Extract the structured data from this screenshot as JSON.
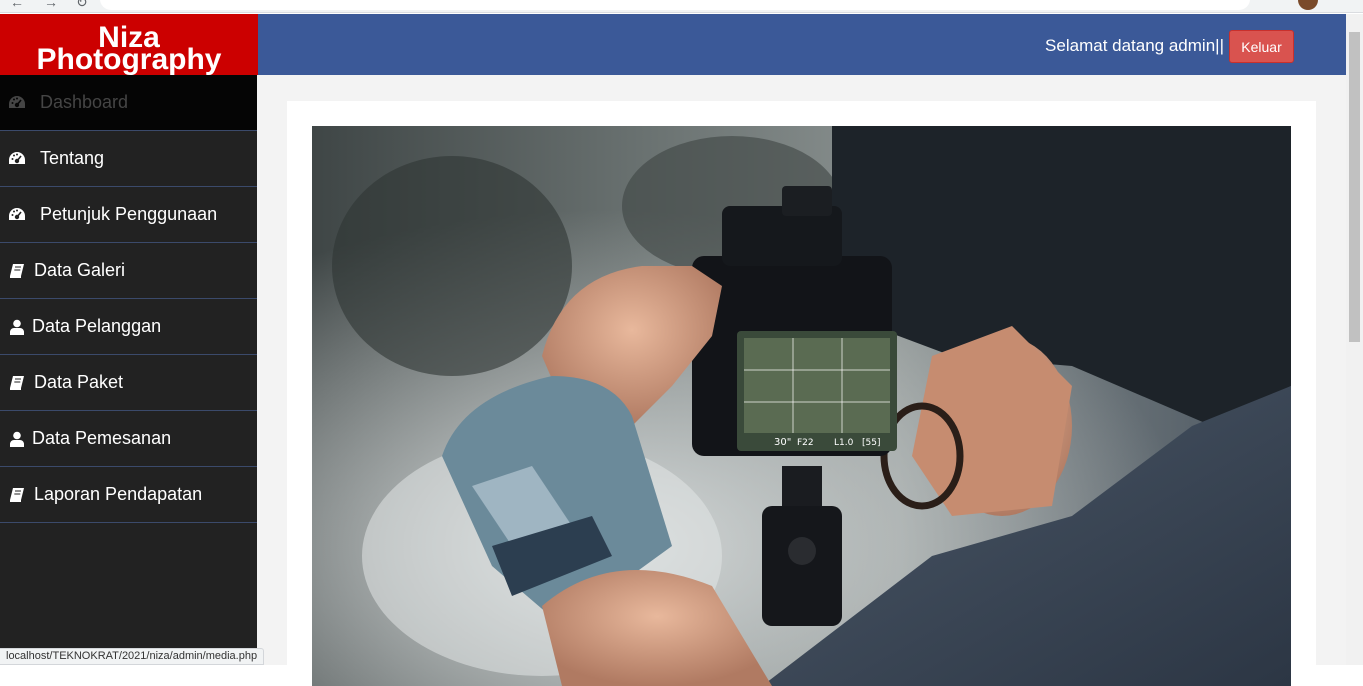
{
  "brand": {
    "line1": "Niza",
    "line2": "Photography",
    "color": "#cc0000"
  },
  "header": {
    "welcome": "Selamat datang admin||",
    "logout_label": "Keluar",
    "color": "#3b5998",
    "logout_color": "#d9534f"
  },
  "sidebar": {
    "items": [
      {
        "label": "Dashboard",
        "icon": "dashboard-icon",
        "active": true
      },
      {
        "label": "Tentang",
        "icon": "dashboard-icon",
        "active": false
      },
      {
        "label": "Petunjuk Penggunaan",
        "icon": "dashboard-icon",
        "active": false
      },
      {
        "label": "Data Galeri",
        "icon": "book-icon",
        "active": false
      },
      {
        "label": "Data Pelanggan",
        "icon": "user-icon",
        "active": false
      },
      {
        "label": "Data Paket",
        "icon": "book-icon",
        "active": false
      },
      {
        "label": "Data Pemesanan",
        "icon": "user-icon",
        "active": false
      },
      {
        "label": "Laporan Pendapatan",
        "icon": "book-icon",
        "active": false
      }
    ]
  },
  "main": {
    "camera_lcd": {
      "shutter": "30\"",
      "aperture": "F22",
      "ev": "L1.0",
      "shots": "[55]"
    }
  },
  "status_bar": {
    "url": "localhost/TEKNOKRAT/2021/niza/admin/media.php"
  }
}
